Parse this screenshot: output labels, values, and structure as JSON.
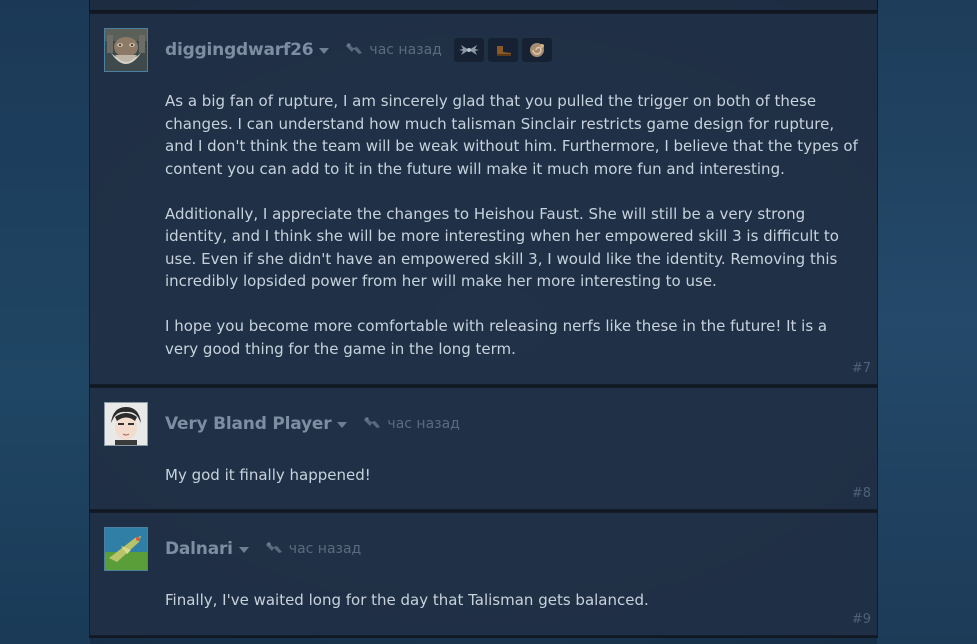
{
  "comments": [
    {
      "author": "diggingdwarf26",
      "time": "час назад",
      "paragraphs": [
        "As a big fan of rupture, I am sincerely glad that you pulled the trigger on both of these changes. I can understand how much talisman Sinclair restricts game design for rupture, and I don't think the team will be weak without him. Furthermore, I believe that the types of content you can add to it in the future will make it much more fun and interesting.",
        "Additionally, I appreciate the changes to Heishou Faust. She will still be a very strong identity, and I think she will be more interesting when her empowered skill 3 is difficult to use. Even if she didn't have an empowered skill 3, I would like the identity. Removing this incredibly lopsided power from her will make her more interesting to use.",
        "I hope you become more comfortable with releasing nerfs like these in the future! It is a very good thing for the game in the long term."
      ],
      "number": "#7",
      "badges": [
        "wings-badge-icon",
        "boot-badge-icon",
        "shell-badge-icon"
      ]
    },
    {
      "author": "Very Bland Player",
      "time": "час назад",
      "paragraphs": [
        "My god it finally happened!"
      ],
      "number": "#8"
    },
    {
      "author": "Dalnari",
      "time": "час назад",
      "paragraphs": [
        "Finally, I've waited long for the day that Talisman gets balanced."
      ],
      "number": "#9"
    }
  ],
  "colors": {
    "panel": "#202f45",
    "author": "#7d8ea2",
    "text": "#c7d2dd",
    "muted": "#5b6b7d"
  }
}
